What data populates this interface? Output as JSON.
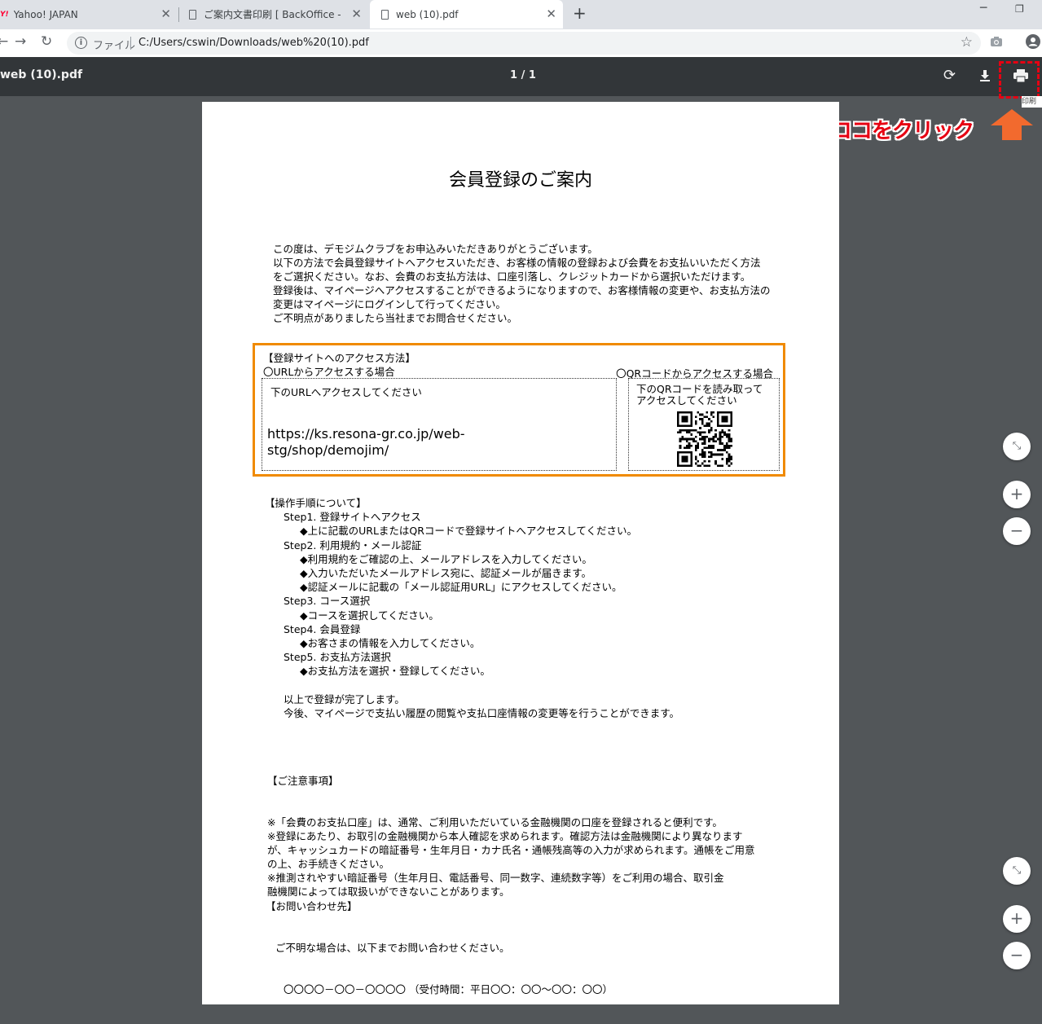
{
  "browser": {
    "tabs": [
      {
        "title": "Yahoo! JAPAN",
        "favicon": "yahoo-favicon"
      },
      {
        "title": "ご案内文書印刷 [ BackOffice - pu",
        "favicon": "document-icon"
      },
      {
        "title": "web (10).pdf",
        "favicon": "document-icon",
        "active": true
      }
    ],
    "new_tab_label": "+",
    "address": {
      "file_label": "ファイル",
      "url": "C:/Users/cswin/Downloads/web%20(10).pdf"
    }
  },
  "pdf_viewer": {
    "filename": "web (10).pdf",
    "page_indicator": "1 / 1",
    "tooltip": "印刷"
  },
  "annotation": {
    "callout": "ココをクリック",
    "highlight_color": "#e60012",
    "arrow_color": "#f26a2e"
  },
  "document": {
    "title": "会員登録のご案内",
    "intro": "この度は、デモジムクラブをお申込みいただきありがとうございます。\n以下の方法で会員登録サイトへアクセスいただき、お客様の情報の登録および会費をお支払いいただく方法\nをご選択ください。なお、会費のお支払方法は、口座引落し、クレジットカードから選択いただけます。\n登録後は、マイページへアクセスすることができるようになりますので、お客様情報の変更や、お支払方法の\n変更はマイページにログインして行ってください。\nご不明点がありましたら当社までお問合せください。",
    "access": {
      "heading": "【登録サイトへのアクセス方法】",
      "url_heading": "〇URLからアクセスする場合",
      "qr_heading": "〇QRコードからアクセスする場合",
      "url_instruction": "下のURLへアクセスしてください",
      "url": "https://ks.resona-gr.co.jp/web-stg/shop/demojim/",
      "qr_instruction": "下のQRコードを読み取って\nアクセスしてください",
      "box_color": "#f08a00"
    },
    "steps_heading": "【操作手順について】",
    "steps": [
      {
        "title": "Step1. 登録サイトへアクセス",
        "items": [
          "◆上に記載のURLまたはQRコードで登録サイトへアクセスしてください。"
        ]
      },
      {
        "title": "Step2. 利用規約・メール認証",
        "items": [
          "◆利用規約をご確認の上、メールアドレスを入力してください。",
          "◆入力いただいたメールアドレス宛に、認証メールが届きます。",
          "◆認証メールに記載の「メール認証用URL」にアクセスしてください。"
        ]
      },
      {
        "title": "Step3. コース選択",
        "items": [
          "◆コースを選択してください。"
        ]
      },
      {
        "title": "Step4. 会員登録",
        "items": [
          "◆お客さまの情報を入力してください。"
        ]
      },
      {
        "title": "Step5. お支払方法選択",
        "items": [
          "◆お支払方法を選択・登録してください。"
        ]
      }
    ],
    "completion": [
      "以上で登録が完了します。",
      "今後、マイページで支払い履歴の閲覧や支払口座情報の変更等を行うことができます。"
    ],
    "notes_heading": "【ご注意事項】",
    "notes": "※「会費のお支払口座」は、通常、ご利用いただいている金融機関の口座を登録されると便利です。\n※登録にあたり、お取引の金融機関から本人確認を求められます。確認方法は金融機関により異なります\nが、キャッシュカードの暗証番号・生年月日・カナ氏名・通帳残高等の入力が求められます。通帳をご用意\nの上、お手続きください。\n※推測されやすい暗証番号（生年月日、電話番号、同一数字、連続数字等）をご利用の場合、取引金\n融機関によっては取扱いができないことがあります。",
    "contact_heading": "【お問い合わせ先】",
    "contact_line1": "ご不明な場合は、以下までお問い合わせください。",
    "contact_line2": "〇〇〇〇－〇〇－〇〇〇〇 （受付時間：平日〇〇：〇〇～〇〇：〇〇）"
  }
}
